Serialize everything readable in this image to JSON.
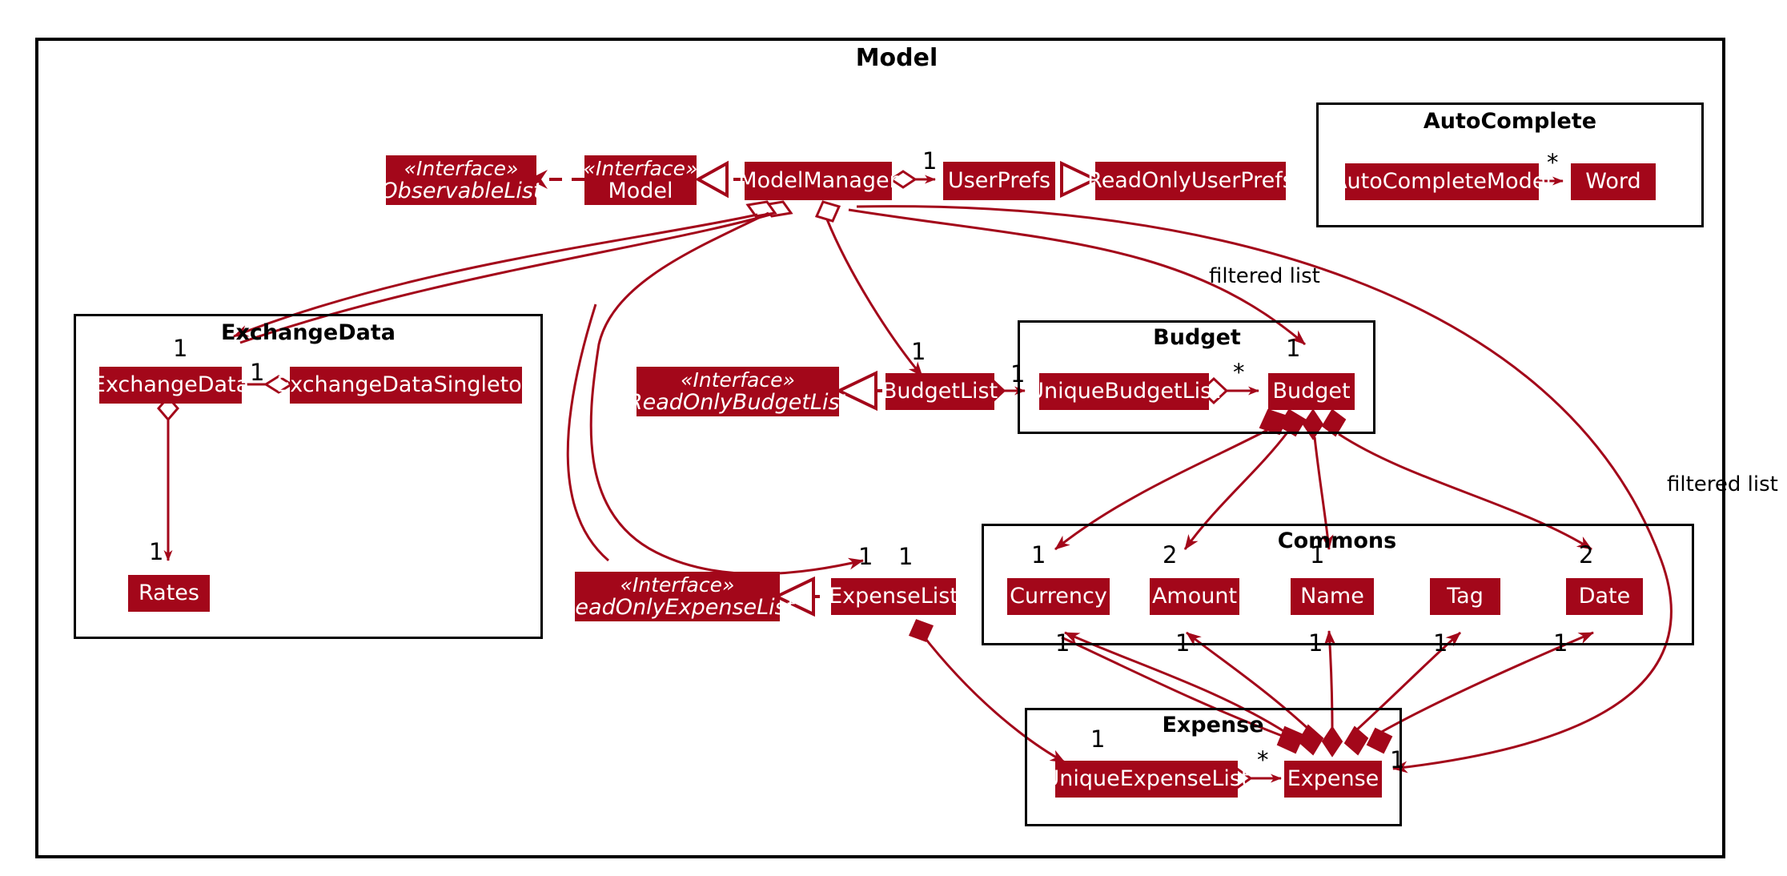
{
  "diagram": {
    "title": "Model",
    "accent_color": "#A3071A",
    "frame_color": "#000000",
    "background": "#FFFFFF"
  },
  "packages": [
    {
      "id": "model",
      "title": "Model"
    },
    {
      "id": "autocomplete",
      "title": "AutoComplete"
    },
    {
      "id": "exchangedata",
      "title": "ExchangeData"
    },
    {
      "id": "budget",
      "title": "Budget"
    },
    {
      "id": "commons",
      "title": "Commons"
    },
    {
      "id": "expense",
      "title": "Expense"
    }
  ],
  "classes": [
    {
      "id": "observablelist",
      "stereotype": "«Interface»",
      "name": "ObservableList",
      "kind": "interface"
    },
    {
      "id": "modeliface",
      "stereotype": "«Interface»",
      "name": "Model",
      "kind": "interface"
    },
    {
      "id": "modelmanager",
      "stereotype": "",
      "name": "ModelManager",
      "kind": "class"
    },
    {
      "id": "userprefs",
      "stereotype": "",
      "name": "UserPrefs",
      "kind": "class"
    },
    {
      "id": "readonlyuserprefs",
      "stereotype": "",
      "name": "ReadOnlyUserPrefs",
      "kind": "class"
    },
    {
      "id": "autocompletemodel",
      "stereotype": "",
      "name": "AutoCompleteModel",
      "kind": "class"
    },
    {
      "id": "word",
      "stereotype": "",
      "name": "Word",
      "kind": "class"
    },
    {
      "id": "exchangedata",
      "stereotype": "",
      "name": "ExchangeData",
      "kind": "class"
    },
    {
      "id": "exchangedatasingleton",
      "stereotype": "",
      "name": "ExchangeDataSingleton",
      "kind": "class"
    },
    {
      "id": "rates",
      "stereotype": "",
      "name": "Rates",
      "kind": "class"
    },
    {
      "id": "readonlybudgetlist",
      "stereotype": "«Interface»",
      "name": "ReadOnlyBudgetList",
      "kind": "interface"
    },
    {
      "id": "budgetlist",
      "stereotype": "",
      "name": "BudgetList",
      "kind": "class"
    },
    {
      "id": "uniquebudgetlist",
      "stereotype": "",
      "name": "UniqueBudgetList",
      "kind": "class"
    },
    {
      "id": "budget",
      "stereotype": "",
      "name": "Budget",
      "kind": "class"
    },
    {
      "id": "readonlyexpenselist",
      "stereotype": "«Interface»",
      "name": "ReadOnlyExpenseList",
      "kind": "interface"
    },
    {
      "id": "expenselist",
      "stereotype": "",
      "name": "ExpenseList",
      "kind": "class"
    },
    {
      "id": "uniqueexpenselist",
      "stereotype": "",
      "name": "UniqueExpenseList",
      "kind": "class"
    },
    {
      "id": "expense",
      "stereotype": "",
      "name": "Expense",
      "kind": "class"
    },
    {
      "id": "currency",
      "stereotype": "",
      "name": "Currency",
      "kind": "class"
    },
    {
      "id": "amount",
      "stereotype": "",
      "name": "Amount",
      "kind": "class"
    },
    {
      "id": "name",
      "stereotype": "",
      "name": "Name",
      "kind": "class"
    },
    {
      "id": "tag",
      "stereotype": "",
      "name": "Tag",
      "kind": "class"
    },
    {
      "id": "date",
      "stereotype": "",
      "name": "Date",
      "kind": "class"
    }
  ],
  "multiplicities": [
    {
      "id": "m_userprefs",
      "text": "1"
    },
    {
      "id": "m_word",
      "text": "*"
    },
    {
      "id": "m_exchangedata",
      "text": "1"
    },
    {
      "id": "m_exchsingleton",
      "text": "1"
    },
    {
      "id": "m_rates",
      "text": "1"
    },
    {
      "id": "m_budgetlist",
      "text": "1"
    },
    {
      "id": "m_uniquebudgetlist",
      "text": "1"
    },
    {
      "id": "m_budgetstar",
      "text": "*"
    },
    {
      "id": "m_budget",
      "text": "1"
    },
    {
      "id": "m_expenselist_a",
      "text": "1"
    },
    {
      "id": "m_expenselist_b",
      "text": "1"
    },
    {
      "id": "m_uniqueexpenselist",
      "text": "1"
    },
    {
      "id": "m_expensestar",
      "text": "*"
    },
    {
      "id": "m_expense_right",
      "text": "1"
    },
    {
      "id": "m_currency_top",
      "text": "1"
    },
    {
      "id": "m_amount_top",
      "text": "2"
    },
    {
      "id": "m_name_top",
      "text": "1"
    },
    {
      "id": "m_date_top",
      "text": "2"
    },
    {
      "id": "m_currency_bot",
      "text": "1"
    },
    {
      "id": "m_amount_bot",
      "text": "1"
    },
    {
      "id": "m_name_bot",
      "text": "1"
    },
    {
      "id": "m_tag_bot",
      "text": "1"
    },
    {
      "id": "m_date_bot",
      "text": "1"
    }
  ],
  "edge_labels": [
    {
      "id": "filtered_list_top",
      "text": "filtered list"
    },
    {
      "id": "filtered_list_right",
      "text": "filtered list"
    }
  ]
}
